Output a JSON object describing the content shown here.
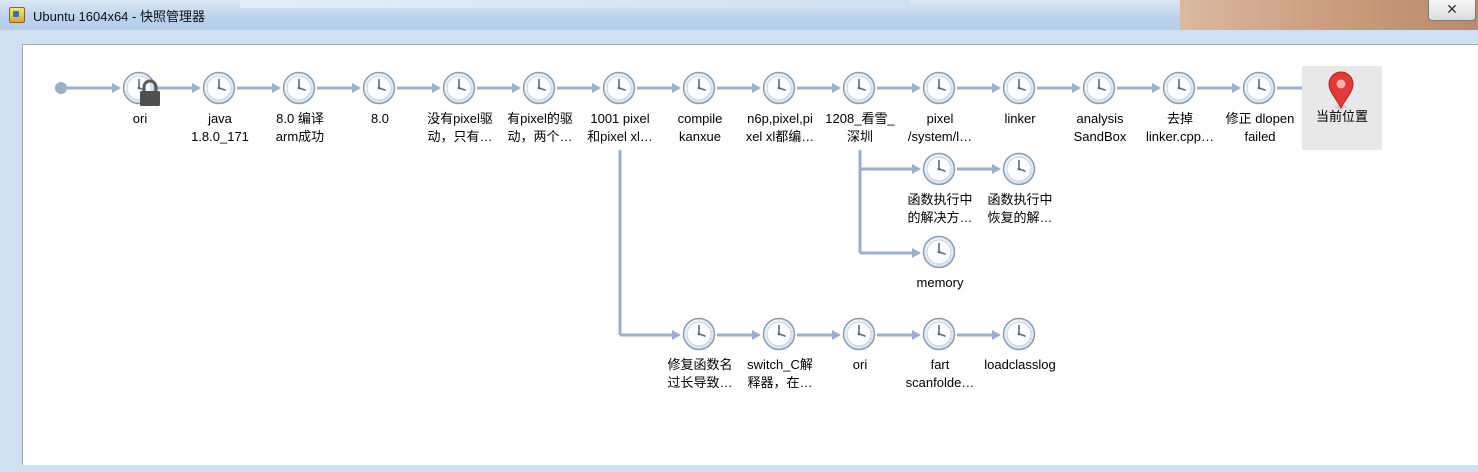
{
  "window": {
    "title": "Ubuntu 1604x64 - 快照管理器",
    "close_label": "✕"
  },
  "colors": {
    "connector": "#9aafc9",
    "accent_pin": "#e03a3a"
  },
  "snapshots": [
    {
      "id": "ori",
      "label": [
        "ori"
      ],
      "locked": true
    },
    {
      "id": "java",
      "label": [
        "java",
        "1.8.0_171"
      ]
    },
    {
      "id": "80-compile",
      "label": [
        "8.0 编译",
        "arm成功"
      ]
    },
    {
      "id": "80",
      "label": [
        "8.0"
      ]
    },
    {
      "id": "no-pixel-driver",
      "label": [
        "没有pixel驱",
        "动，只有…"
      ]
    },
    {
      "id": "pixel-driver",
      "label": [
        "有pixel的驱",
        "动，两个…"
      ]
    },
    {
      "id": "1001-pixel",
      "label": [
        "1001 pixel",
        "和pixel xl…"
      ]
    },
    {
      "id": "compile-kanxue",
      "label": [
        "compile",
        "kanxue"
      ]
    },
    {
      "id": "n6p",
      "label": [
        "n6p,pixel,pi",
        "xel xl都编…"
      ]
    },
    {
      "id": "1208",
      "label": [
        "1208_看雪_",
        "深圳"
      ]
    },
    {
      "id": "pixel-system",
      "label": [
        "pixel",
        "/system/l…"
      ]
    },
    {
      "id": "linker",
      "label": [
        "linker"
      ]
    },
    {
      "id": "analysis-sandbox",
      "label": [
        "analysis",
        "SandBox"
      ]
    },
    {
      "id": "remove-linker",
      "label": [
        "去掉",
        "linker.cpp…"
      ]
    },
    {
      "id": "fix-dlopen",
      "label": [
        "修正  dlopen",
        "failed"
      ]
    },
    {
      "id": "func-exec-1",
      "label": [
        "函数执行中",
        "的解决方…"
      ]
    },
    {
      "id": "func-exec-2",
      "label": [
        "函数执行中",
        "恢复的解…"
      ]
    },
    {
      "id": "memory",
      "label": [
        "memory"
      ]
    },
    {
      "id": "fix-func-name",
      "label": [
        "修复函数名",
        "过长导致…"
      ]
    },
    {
      "id": "switch-c",
      "label": [
        "switch_C解",
        "释器，在…"
      ]
    },
    {
      "id": "ori-2",
      "label": [
        "ori"
      ]
    },
    {
      "id": "fart",
      "label": [
        "fart",
        "scanfolde…"
      ]
    },
    {
      "id": "loadclasslog",
      "label": [
        "loadclasslog"
      ]
    }
  ],
  "current_position": {
    "label": "当前位置"
  }
}
